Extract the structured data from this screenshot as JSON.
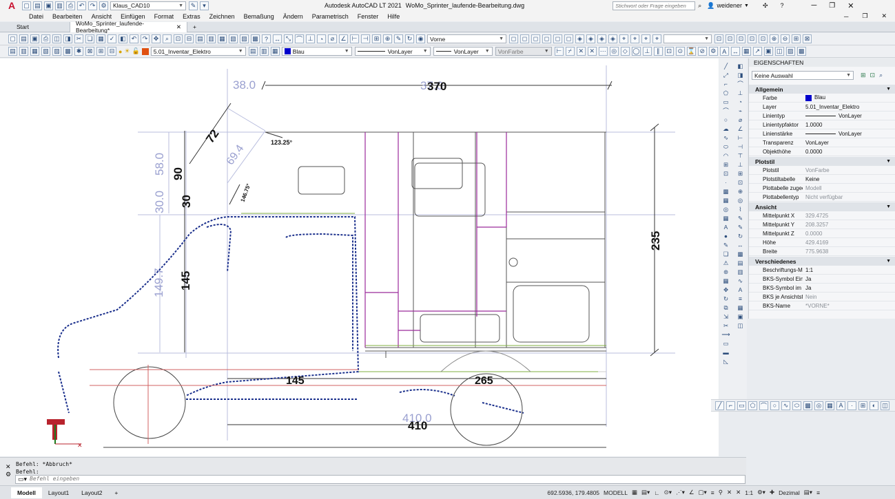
{
  "titlebar": {
    "app_name": "Autodesk AutoCAD LT 2021",
    "file_name": "WoMo_Sprinter_laufende-Bearbeitung.dwg",
    "workspace": "Klaus_CAD10",
    "search_placeholder": "Stichwort oder Frage eingeben",
    "user": "weidener"
  },
  "menu": [
    "Datei",
    "Bearbeiten",
    "Ansicht",
    "Einfügen",
    "Format",
    "Extras",
    "Zeichnen",
    "Bemaßung",
    "Ändern",
    "Parametrisch",
    "Fenster",
    "Hilfe"
  ],
  "tabs": {
    "start": "Start",
    "drawing": "WoMo_Sprinter_laufende-Bearbeitung*",
    "add": "+"
  },
  "toolbar": {
    "view": "Vorne",
    "layer": "5.01_Inventar_Elektro",
    "color": "Blau",
    "linetype": "VonLayer",
    "lineweight": "VonLayer",
    "plotstyle": "VonFarbe"
  },
  "drawing": {
    "dims": {
      "d370": "370",
      "d38": "38.0",
      "d38b": "37.0",
      "d72": "72",
      "d69": "69.4",
      "d90": "90",
      "d58": "58.0",
      "d30": "30",
      "d30b": "30.0",
      "d145v": "145",
      "d149": "149.7",
      "d235": "235",
      "d145h": "145",
      "d265": "265",
      "d410": "410",
      "d410b": "410.0",
      "ang1": "123.25°",
      "ang2": "146.75°"
    }
  },
  "properties": {
    "title": "EIGENSCHAFTEN",
    "selection": "Keine Auswahl",
    "sections": [
      {
        "name": "Allgemein",
        "rows": [
          {
            "k": "Farbe",
            "v": "Blau",
            "swatch": "#0000cc"
          },
          {
            "k": "Layer",
            "v": "5.01_Inventar_Elektro"
          },
          {
            "k": "Linientyp",
            "v": "VonLayer",
            "line": true
          },
          {
            "k": "Linientypfaktor",
            "v": "1.0000"
          },
          {
            "k": "Linienstärke",
            "v": "VonLayer",
            "line": true
          },
          {
            "k": "Transparenz",
            "v": "VonLayer"
          },
          {
            "k": "Objekthöhe",
            "v": "0.0000"
          }
        ]
      },
      {
        "name": "Plotstil",
        "rows": [
          {
            "k": "Plotstil",
            "v": "VonFarbe",
            "dim": true
          },
          {
            "k": "Plotstiltabelle",
            "v": "Keine"
          },
          {
            "k": "Plottabelle zugeor...",
            "v": "Modell",
            "dim": true
          },
          {
            "k": "Plottabellentyp",
            "v": "Nicht verfügbar",
            "dim": true
          }
        ]
      },
      {
        "name": "Ansicht",
        "rows": [
          {
            "k": "Mittelpunkt X",
            "v": "329.4725",
            "dim": true
          },
          {
            "k": "Mittelpunkt Y",
            "v": "208.3257",
            "dim": true
          },
          {
            "k": "Mittelpunkt Z",
            "v": "0.0000",
            "dim": true
          },
          {
            "k": "Höhe",
            "v": "429.4169",
            "dim": true
          },
          {
            "k": "Breite",
            "v": "775.9638",
            "dim": true
          }
        ]
      },
      {
        "name": "Verschiedenes",
        "rows": [
          {
            "k": "Beschriftungs-Ma...",
            "v": "1:1"
          },
          {
            "k": "BKS-Symbol Ein",
            "v": "Ja"
          },
          {
            "k": "BKS-Symbol im Ur...",
            "v": "Ja"
          },
          {
            "k": "BKS je Ansichtsfen...",
            "v": "Nein",
            "dim": true
          },
          {
            "k": "BKS-Name",
            "v": "*VORNE*",
            "dim": true
          }
        ]
      }
    ]
  },
  "command": {
    "line1": "Befehl: *Abbruch*",
    "line2": "Befehl:",
    "placeholder": "Befehl eingeben"
  },
  "status": {
    "layout_tabs": [
      "Modell",
      "Layout1",
      "Layout2"
    ],
    "coords": "692.5936, 179.4805",
    "space": "MODELL",
    "scale": "1:1",
    "units": "Dezimal"
  },
  "colors": {
    "dim": "#b9bede",
    "dim_text": "#9aa0d0",
    "outline": "#555555",
    "vehicle": "#1a2f8c",
    "interior": "#9b2a9b",
    "wheel": "#444444"
  }
}
